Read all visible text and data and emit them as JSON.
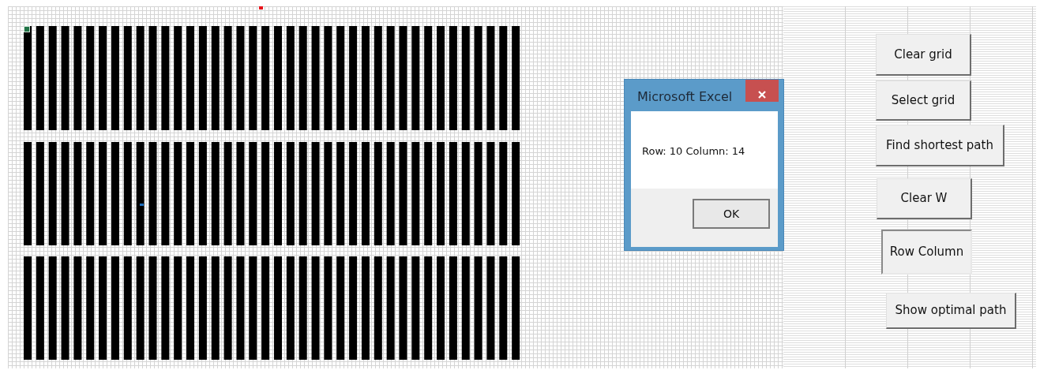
{
  "sheet_buttons": [
    {
      "label": "Clear grid"
    },
    {
      "label": "Select grid"
    },
    {
      "label": "Find shortest path"
    },
    {
      "label": "Clear W"
    },
    {
      "label": "Row Column"
    },
    {
      "label": "Show optimal path"
    }
  ],
  "dialog": {
    "title": "Microsoft Excel",
    "message": "Row: 10 Column: 14",
    "button": "OK"
  }
}
